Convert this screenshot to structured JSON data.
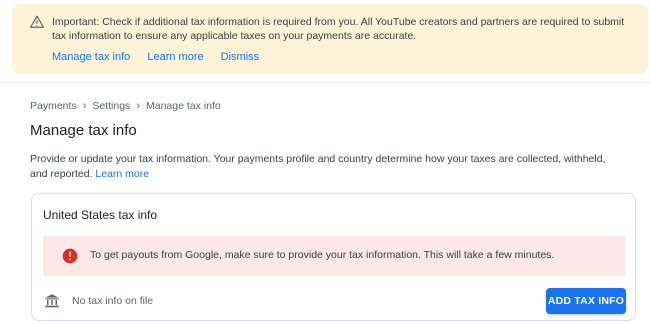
{
  "banner": {
    "icon": "warning-icon",
    "message": "Important: Check if additional tax information is required from you. All YouTube creators and partners are required to submit tax information to ensure any applicable taxes on your payments are accurate.",
    "links": [
      "Manage tax info",
      "Learn more",
      "Dismiss"
    ],
    "background": "#fdf4d8"
  },
  "breadcrumb": {
    "items": [
      "Payments",
      "Settings",
      "Manage tax info"
    ],
    "separator_icon": "chevron-right-icon"
  },
  "page": {
    "title": "Manage tax info",
    "description": "Provide or update your tax information. Your payments profile and country determine how your taxes are collected, withheld, and reported.",
    "description_link": "Learn more"
  },
  "card": {
    "title": "United States tax info",
    "alert": {
      "icon": "error-icon",
      "text": "To get payouts from Google, make sure to provide your tax information. This will take a few minutes.",
      "background": "#fce8e6",
      "icon_color": "#d93025"
    },
    "status_icon": "bank-icon",
    "status_text": "No tax info on file",
    "button_label": "ADD TAX INFO",
    "accent": "#1a73e8"
  }
}
